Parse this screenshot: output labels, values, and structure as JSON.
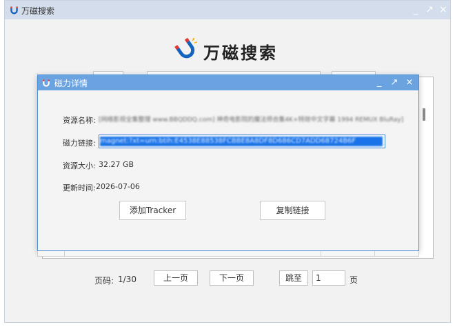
{
  "app": {
    "title": "万磁搜索",
    "logo_text": "万磁搜索",
    "window_controls": [
      "_",
      "↗",
      "×"
    ]
  },
  "details_dialog": {
    "title": "磁力详情",
    "controls": [
      "_",
      "↗",
      "×"
    ],
    "fields": {
      "name_label": "资源名称:",
      "name_value": "[网络影视全集整理 www.BBQDDQ.com] 神奇电影院的魔法师合集4K+特效中文字幕 1994 REMUX BluRay]",
      "link_label": "磁力链接:",
      "link_value": "magnet:?xt=urn:btih:E4538E88538FCBBE8A8DF8D686CD7ADD68724B6F",
      "size_label": "资源大小:",
      "size_value": "32.27 GB",
      "time_label": "更新时间:",
      "time_value": "2026-07-06"
    },
    "buttons": {
      "add_tracker": "添加Tracker",
      "copy_link": "复制链接"
    }
  },
  "pager": {
    "page_label": "页码:",
    "page_value": "1/30",
    "prev": "上一页",
    "next": "下一页",
    "jump": "跳至",
    "jump_input": "1",
    "page_suffix": "页"
  },
  "colors": {
    "main_titlebar": "#d3ddeb",
    "dialog_titlebar": "#6aa3e0",
    "selection": "#1a73e8",
    "logo_blue": "#1565c0",
    "logo_red": "#e53935"
  }
}
